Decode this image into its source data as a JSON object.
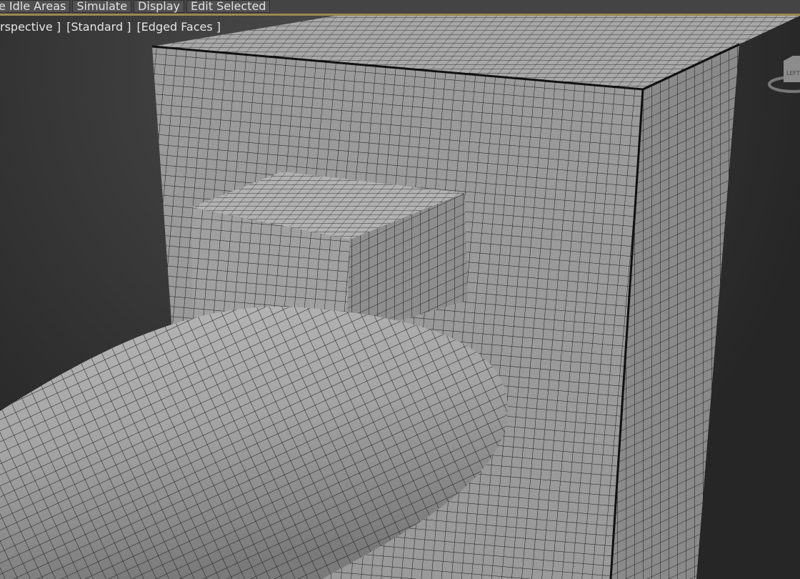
{
  "toolbar": {
    "items": [
      "e Idle Areas",
      "Simulate",
      "Display",
      "Edit Selected"
    ]
  },
  "viewport": {
    "labels": [
      "rspective ]",
      "[Standard ]",
      "[Edged Faces ]"
    ],
    "viewcube_face": "LEFT"
  },
  "colors": {
    "gold_accent": "#9b8753",
    "mesh_wire": "#1a1a1a"
  }
}
